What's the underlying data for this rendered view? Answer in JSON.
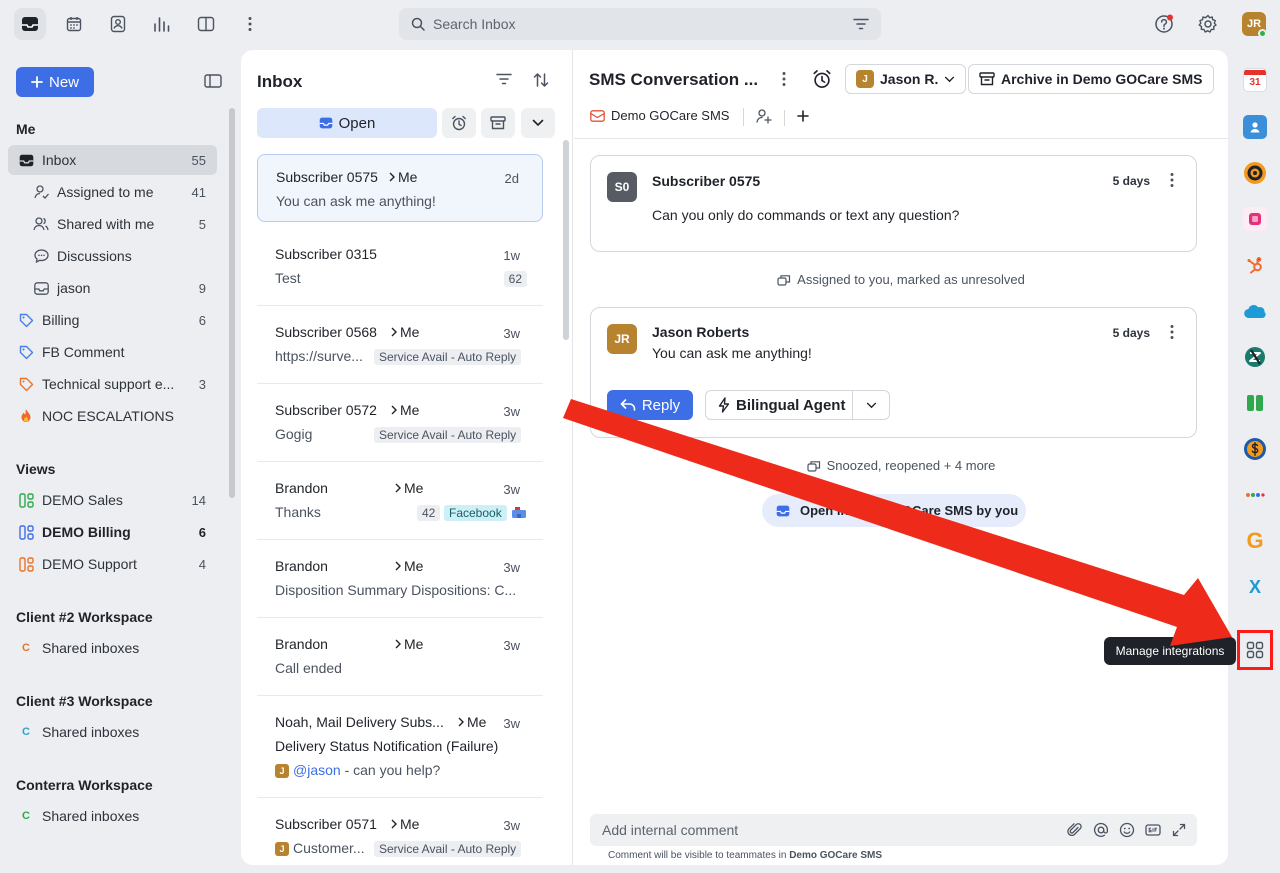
{
  "topbar": {
    "search_placeholder": "Search Inbox",
    "user_initials": "JR"
  },
  "sidebar": {
    "new_label": "New",
    "me_title": "Me",
    "me_items": [
      {
        "label": "Inbox",
        "count": "55"
      },
      {
        "label": "Assigned to me",
        "count": "41"
      },
      {
        "label": "Shared with me",
        "count": "5"
      },
      {
        "label": "Discussions",
        "count": ""
      },
      {
        "label": "jason",
        "count": "9"
      },
      {
        "label": "Billing",
        "count": "6"
      },
      {
        "label": "FB Comment",
        "count": ""
      },
      {
        "label": "Technical support e...",
        "count": "3"
      },
      {
        "label": "NOC ESCALATIONS",
        "count": ""
      }
    ],
    "views_title": "Views",
    "views": [
      {
        "label": "DEMO Sales",
        "count": "14"
      },
      {
        "label": "DEMO Billing",
        "count": "6"
      },
      {
        "label": "DEMO Support",
        "count": "4"
      }
    ],
    "workspaces": [
      {
        "title": "Client #2 Workspace",
        "item": "Shared inboxes",
        "letter": "C",
        "color": "#e8732c"
      },
      {
        "title": "Client #3 Workspace",
        "item": "Shared inboxes",
        "letter": "C",
        "color": "#2aa6c9"
      },
      {
        "title": "Conterra Workspace",
        "item": "Shared inboxes",
        "letter": "C",
        "color": "#2fa84f"
      }
    ]
  },
  "list": {
    "title": "Inbox",
    "open_label": "Open",
    "conversations": [
      {
        "who": "Subscriber 0575",
        "me": "Me",
        "time": "2d",
        "preview": "You can ask me anything!"
      },
      {
        "who": "Subscriber 0315",
        "me": "",
        "time": "1w",
        "preview": "Test",
        "badge": "62"
      },
      {
        "who": "Subscriber 0568",
        "me": "Me",
        "time": "3w",
        "preview": "https://surve...",
        "tag": "Service Avail - Auto Reply"
      },
      {
        "who": "Subscriber 0572",
        "me": "Me",
        "time": "3w",
        "preview": "Gogig",
        "tag": "Service Avail - Auto Reply"
      },
      {
        "who": "Brandon",
        "me": "Me",
        "time": "3w",
        "preview": "Thanks",
        "badge": "42",
        "tag": "Facebook"
      },
      {
        "who": "Brandon",
        "me": "Me",
        "time": "3w",
        "preview": "Disposition Summary Dispositions: C..."
      },
      {
        "who": "Brandon",
        "me": "Me",
        "time": "3w",
        "preview": "Call ended"
      },
      {
        "who": "Noah, Mail Delivery Subs...",
        "me": "Me",
        "time": "3w",
        "preview": "Delivery Status Notification (Failure)",
        "mention": "@jason",
        "mention_rest": " - can you help?"
      },
      {
        "who": "Subscriber 0571",
        "me": "Me",
        "time": "3w",
        "preview": "Customer...",
        "tag": "Service Avail - Auto Reply"
      }
    ]
  },
  "conversation": {
    "title": "SMS Conversation ...",
    "assignee": "Jason R.",
    "archive_label": "Archive in Demo GOCare SMS",
    "inbox_tag": "Demo GOCare SMS",
    "messages": [
      {
        "initials": "S0",
        "sender": "Subscriber 0575",
        "ago": "5 days",
        "body": "Can you only do commands or text any question?"
      },
      {
        "initials": "JR",
        "sender": "Jason Roberts",
        "ago": "5 days",
        "body": "You can ask me anything!"
      }
    ],
    "event1": "Assigned to you, marked as unresolved",
    "reply_label": "Reply",
    "agent_label": "Bilingual Agent",
    "event2": "Snoozed, reopened + 4 more",
    "status": "Open in Demo GOCare SMS by you",
    "comment_placeholder": "Add internal comment",
    "note_prefix": "Comment will be visible to teammates in ",
    "note_inbox": "Demo GOCare SMS"
  },
  "rail": {
    "calendar_day": "31",
    "tooltip": "Manage integrations"
  },
  "colors": {
    "accent": "#3e6ee6",
    "highlight": "#ff1a1a",
    "arrow": "#ee2a1a"
  }
}
